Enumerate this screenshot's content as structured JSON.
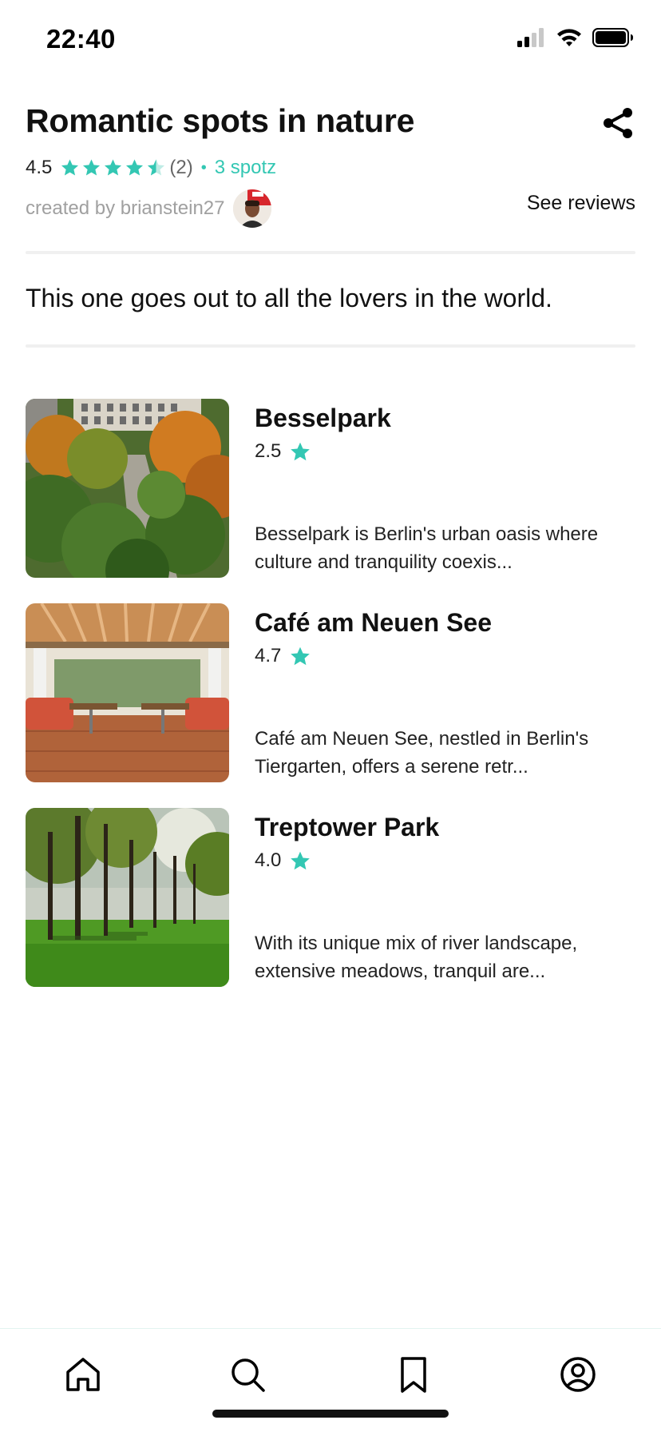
{
  "status_bar": {
    "time": "22:40"
  },
  "header": {
    "title": "Romantic spots in nature",
    "rating": "4.5",
    "rating_stars": 4.5,
    "review_count": "(2)",
    "separator": "•",
    "spotz_count": "3 spotz",
    "creator_text": "created by brianstein27",
    "see_reviews": "See reviews"
  },
  "description": "This one goes out to all the lovers in the world.",
  "spots": [
    {
      "name": "Besselpark",
      "rating": "2.5",
      "description": "Besselpark is Berlin's urban oasis where culture and tranquility coexis..."
    },
    {
      "name": "Café am Neuen See",
      "rating": "4.7",
      "description": "Café am Neuen See, nestled in Berlin's Tiergarten, offers a serene retr..."
    },
    {
      "name": "Treptower Park",
      "rating": "4.0",
      "description": "With its unique mix of river landscape, extensive meadows, tranquil are..."
    }
  ],
  "tabs": [
    {
      "icon": "home-icon"
    },
    {
      "icon": "search-icon"
    },
    {
      "icon": "bookmark-icon"
    },
    {
      "icon": "profile-icon"
    }
  ],
  "colors": {
    "accent": "#33c7b3",
    "muted_text": "#a0a0a0",
    "divider": "#f0f0f0"
  }
}
